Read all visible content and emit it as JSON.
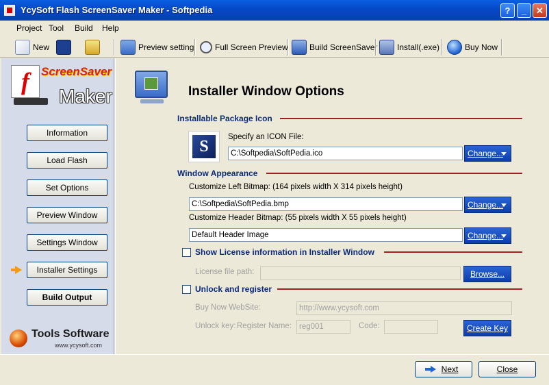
{
  "window": {
    "title": "YcySoft Flash ScreenSaver Maker - Softpedia",
    "help_btn": "?",
    "min_btn": "_",
    "max_btn": "□",
    "close_btn": "✕"
  },
  "menu": {
    "items": [
      "Project",
      "Tool",
      "Build",
      "Help"
    ]
  },
  "toolbar": {
    "new_label": "New",
    "preview_setting": "Preview setting",
    "full_screen_preview": "Full Screen Preview",
    "build_screensaver": "Build ScreenSaver",
    "install": "Install(.exe)",
    "buy_now": "Buy Now"
  },
  "sidebar": {
    "logo_screensaver": "ScreenSaver",
    "logo_maker": "Maker",
    "items": [
      {
        "label": "Information"
      },
      {
        "label": "Load Flash"
      },
      {
        "label": "Set Options"
      },
      {
        "label": "Preview Window"
      },
      {
        "label": "Settings Window"
      },
      {
        "label": "Installer Settings"
      },
      {
        "label": "Build Output"
      }
    ],
    "brand_name": "Tools Software",
    "brand_url": "www.ycysoft.com"
  },
  "main": {
    "page_title": "Installer Window Options",
    "pkg_section": "Installable Package Icon",
    "icon_label": "Specify an ICON File:",
    "icon_path": "C:\\Softpedia\\SoftPedia.ico",
    "icon_glyph": "S",
    "change_label": "Change...",
    "appearance_section": "Window Appearance",
    "left_bitmap_label": "Customize Left Bitmap: (164 pixels width X 314 pixels height)",
    "left_bitmap_value": "C:\\Softpedia\\SoftPedia.bmp",
    "header_bitmap_label": "Customize Header Bitmap: (55 pixels width X 55 pixels height)",
    "header_bitmap_value": "Default Header Image",
    "license_section": "Show License information in Installer Window",
    "license_path_label": "License file path:",
    "license_path_value": "",
    "browse_label": "Browse...",
    "unlock_section": "Unlock and register",
    "buy_now_label": "Buy Now WebSite:",
    "buy_now_value": "http://www.ycysoft.com",
    "unlock_key_label": "Unlock key:",
    "register_name_label": "Register Name:",
    "register_name_value": "reg001",
    "code_label": "Code:",
    "code_value": "",
    "create_key_label": "Create Key"
  },
  "footer": {
    "next_label": "Next",
    "close_label": "Close"
  }
}
